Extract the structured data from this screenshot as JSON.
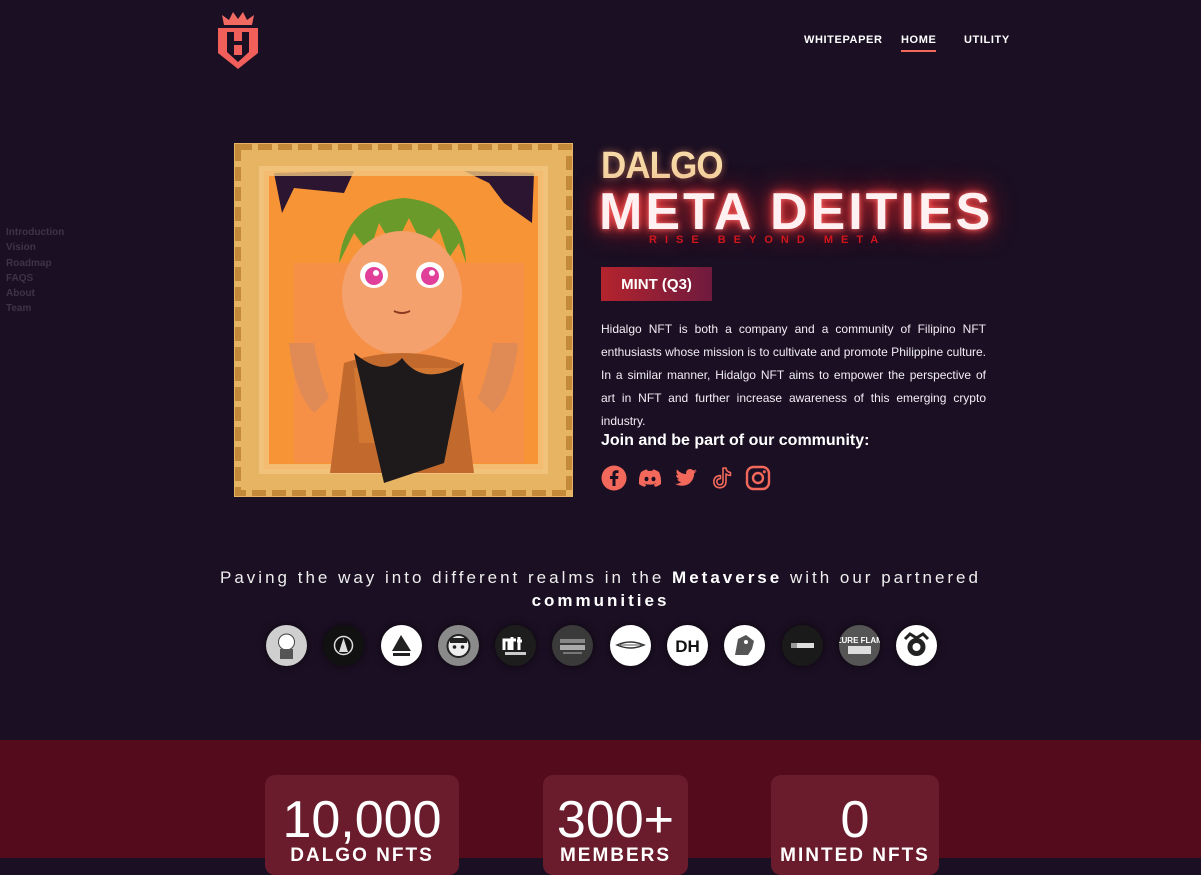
{
  "nav": {
    "items": [
      {
        "label": "WHITEPAPER",
        "active": false
      },
      {
        "label": "HOME",
        "active": true
      },
      {
        "label": "UTILITY",
        "active": false
      }
    ]
  },
  "sidenav": {
    "items": [
      "Introduction",
      "Vision",
      "Roadmap",
      "FAQS",
      "About",
      "Team"
    ]
  },
  "hero": {
    "brand_small": "DALGO",
    "brand_big": "META DEITIES",
    "tagline": "RISE BEYOND META",
    "mint_label": "MINT (Q3)",
    "description": "Hidalgo NFT is both a company and a community of Filipino NFT enthusiasts whose mission is to cultivate and promote Philippine culture. In a similar manner, Hidalgo NFT aims to empower the perspective of art in NFT and further increase awareness of this emerging crypto industry.",
    "join_text": "Join and be part of our community:",
    "socials": [
      "facebook-icon",
      "discord-icon",
      "twitter-icon",
      "tiktok-icon",
      "instagram-icon"
    ]
  },
  "partners": {
    "heading_pre": "Paving the way into different realms in the ",
    "heading_bold1": "Metaverse",
    "heading_mid": " with our partnered ",
    "heading_bold2": "communities",
    "logos": [
      "DH",
      "AZURE FLAME"
    ]
  },
  "stats": [
    {
      "value": "10,000",
      "label": "DALGO NFTS"
    },
    {
      "value": "300+",
      "label": "MEMBERS"
    },
    {
      "value": "0",
      "label": "MINTED NFTS"
    }
  ],
  "colors": {
    "background": "#1b0f23",
    "accent": "#f2685b",
    "stats_band": "#540b1c",
    "stat_card": "#6a1c2c"
  }
}
